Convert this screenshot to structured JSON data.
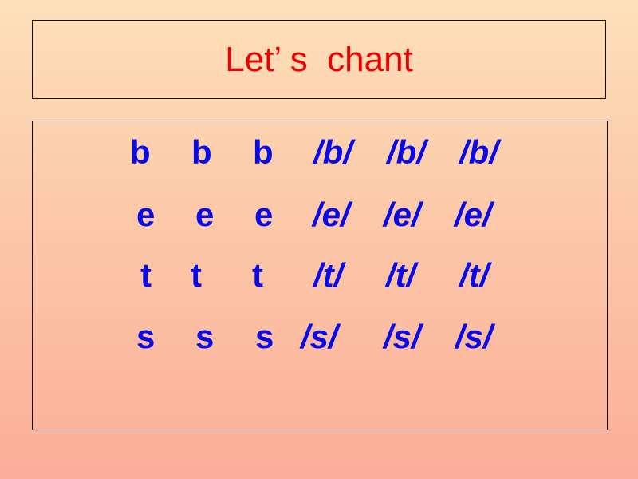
{
  "slide": {
    "title": "Let’ s  chant",
    "rows": [
      {
        "letters": [
          "b",
          "b",
          "b"
        ],
        "sounds": [
          "/b/",
          "/b/",
          "/b/"
        ]
      },
      {
        "letters": [
          "e",
          "e",
          "e"
        ],
        "sounds": [
          "/e/",
          "/e/",
          "/e/"
        ]
      },
      {
        "letters": [
          "t",
          "t",
          "t"
        ],
        "sounds": [
          "/t/",
          "/t/",
          "/t/"
        ]
      },
      {
        "letters": [
          "s",
          "s",
          "s"
        ],
        "sounds": [
          "/s/",
          "/s/",
          "/s/"
        ]
      }
    ]
  },
  "colors": {
    "title": "#ee0000",
    "chant_text": "#0a0ae6",
    "background_top": "#fde0b9",
    "background_bottom": "#fbae99"
  }
}
